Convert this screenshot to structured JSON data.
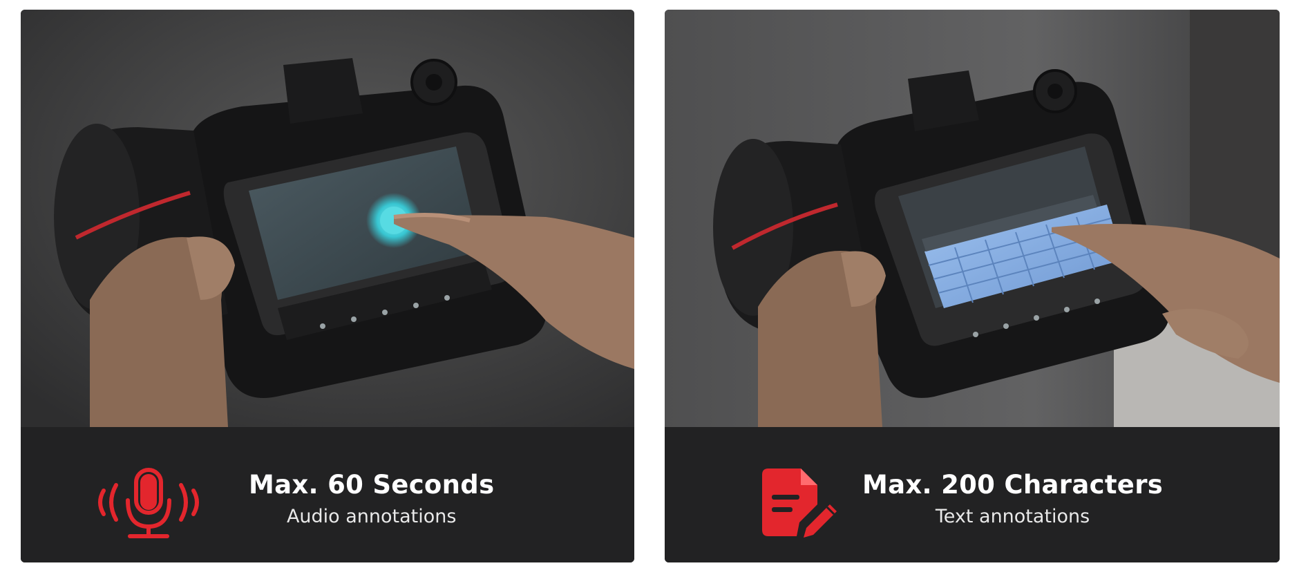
{
  "panels": [
    {
      "id": "audio",
      "title": "Max. 60 Seconds",
      "subtitle": "Audio annotations",
      "icon": "microphone-icon",
      "accent": "#e3262d"
    },
    {
      "id": "text",
      "title": "Max. 200 Characters",
      "subtitle": "Text annotations",
      "icon": "document-pen-icon",
      "accent": "#e3262d"
    }
  ],
  "colors": {
    "background": "#ffffff",
    "panel": "#222223",
    "accent": "#e3262d",
    "screen_glow": "#38c6d2",
    "keyboard": "#7da6dc"
  }
}
